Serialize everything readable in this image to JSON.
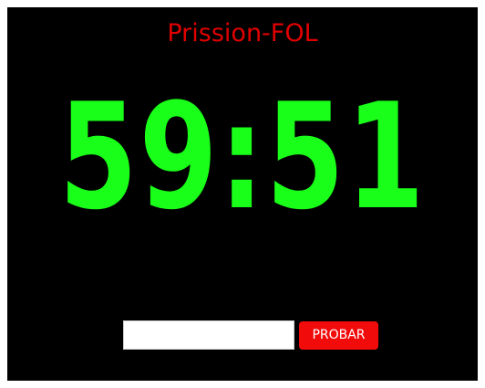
{
  "header": {
    "title": "Prission-FOL"
  },
  "timer": {
    "display": "59:51"
  },
  "form": {
    "input_value": "",
    "input_placeholder": "",
    "submit_label": "PROBAR"
  },
  "colors": {
    "background": "#000000",
    "title": "#e00000",
    "timer": "#19ff19",
    "button": "#f20b0b"
  }
}
